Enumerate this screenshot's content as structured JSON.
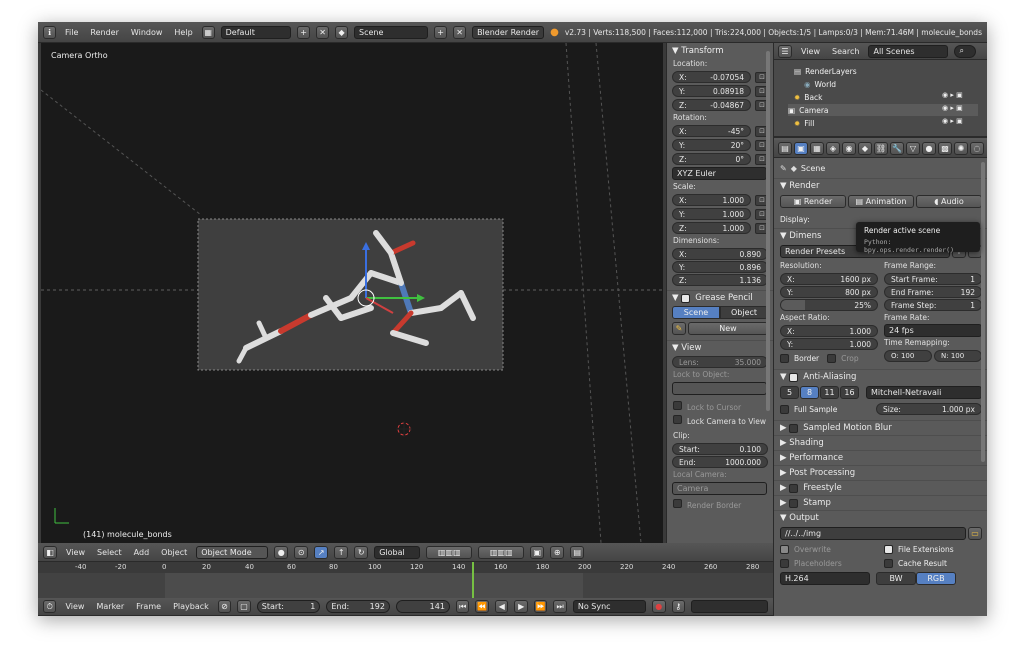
{
  "topbar": {
    "menus": [
      "File",
      "Render",
      "Window",
      "Help"
    ],
    "layout": "Default",
    "scene": "Scene",
    "engine": "Blender Render",
    "stats": "v2.73 | Verts:118,500 | Faces:112,000 | Tris:224,000 | Objects:1/5 | Lamps:0/3 | Mem:71.46M | molecule_bonds"
  },
  "viewport": {
    "view_label": "Camera Ortho",
    "object_label": "(141) molecule_bonds",
    "header": {
      "menus": [
        "View",
        "Select",
        "Add",
        "Object"
      ],
      "mode": "Object Mode",
      "orientation": "Global"
    }
  },
  "npanel": {
    "transform_title": "Transform",
    "location_label": "Location:",
    "location": [
      {
        "axis": "X:",
        "value": "-0.07054"
      },
      {
        "axis": "Y:",
        "value": "0.08918"
      },
      {
        "axis": "Z:",
        "value": "-0.04867"
      }
    ],
    "rotation_label": "Rotation:",
    "rotation": [
      {
        "axis": "X:",
        "value": "-45°"
      },
      {
        "axis": "Y:",
        "value": "20°"
      },
      {
        "axis": "Z:",
        "value": "0°"
      }
    ],
    "rotation_mode": "XYZ Euler",
    "scale_label": "Scale:",
    "scale": [
      {
        "axis": "X:",
        "value": "1.000"
      },
      {
        "axis": "Y:",
        "value": "1.000"
      },
      {
        "axis": "Z:",
        "value": "1.000"
      }
    ],
    "dimensions_label": "Dimensions:",
    "dimensions": [
      {
        "axis": "X:",
        "value": "0.890"
      },
      {
        "axis": "Y:",
        "value": "0.896"
      },
      {
        "axis": "Z:",
        "value": "1.136"
      }
    ],
    "grease_title": "Grease Pencil",
    "grease_tabs": [
      "Scene",
      "Object"
    ],
    "grease_new": "New",
    "view_title": "View",
    "lens_label": "Lens:",
    "lens_value": "35.000",
    "lock_object_label": "Lock to Object:",
    "lock_cursor": "Lock to Cursor",
    "lock_camera": "Lock Camera to View",
    "clip_label": "Clip:",
    "clip_start_label": "Start:",
    "clip_start": "0.100",
    "clip_end_label": "End:",
    "clip_end": "1000.000",
    "local_camera_label": "Local Camera:",
    "local_camera": "Camera",
    "render_border": "Render Border"
  },
  "timeline": {
    "ticks": [
      "-40",
      "-20",
      "0",
      "20",
      "40",
      "60",
      "80",
      "100",
      "120",
      "140",
      "160",
      "180",
      "200",
      "220",
      "240",
      "260",
      "280"
    ],
    "menus": [
      "View",
      "Marker",
      "Frame",
      "Playback"
    ],
    "start_label": "Start:",
    "start": "1",
    "end_label": "End:",
    "end": "192",
    "current": "141",
    "sync": "No Sync"
  },
  "outliner": {
    "menus": [
      "View",
      "Search"
    ],
    "filter": "All Scenes",
    "items": [
      "RenderLayers",
      "World",
      "Back",
      "Camera",
      "Fill"
    ]
  },
  "properties": {
    "scene_label": "Scene",
    "render_title": "Render",
    "render_buttons": [
      "Render",
      "Animation",
      "Audio"
    ],
    "display_label": "Display:",
    "dimensions_title": "Dimens",
    "render_presets": "Render Presets",
    "resolution_label": "Resolution:",
    "res_x_label": "X:",
    "res_x": "1600 px",
    "res_y_label": "Y:",
    "res_y": "800 px",
    "res_pct": "25%",
    "res_pct_fill": 0.25,
    "frame_range_label": "Frame Range:",
    "start_frame_label": "Start Frame:",
    "start_frame": "1",
    "end_frame_label": "End Frame:",
    "end_frame": "192",
    "frame_step_label": "Frame Step:",
    "frame_step": "1",
    "aspect_label": "Aspect Ratio:",
    "aspect_x_label": "X:",
    "aspect_x": "1.000",
    "aspect_y_label": "Y:",
    "aspect_y": "1.000",
    "frame_rate_label": "Frame Rate:",
    "frame_rate": "24 fps",
    "border": "Border",
    "crop": "Crop",
    "time_remap_label": "Time Remapping:",
    "remap_o": "O: 100",
    "remap_n": "N: 100",
    "aa_title": "Anti-Aliasing",
    "aa_samples": [
      "5",
      "8",
      "11",
      "16"
    ],
    "aa_filter": "Mitchell-Netravali",
    "full_sample": "Full Sample",
    "size_label": "Size:",
    "size_value": "1.000 px",
    "collapsed_sections": [
      "Sampled Motion Blur",
      "Shading",
      "Performance",
      "Post Processing",
      "Freestyle",
      "Stamp"
    ],
    "output_title": "Output",
    "output_path": "//../../img",
    "overwrite": "Overwrite",
    "file_extensions": "File Extensions",
    "placeholders": "Placeholders",
    "cache_result": "Cache Result",
    "format": "H.264",
    "color_modes": [
      "BW",
      "RGB"
    ]
  },
  "tooltip": {
    "title": "Render active scene",
    "code": "Python: bpy.ops.render.render()"
  },
  "colors": {
    "accent": "#5680c2",
    "timeline_cursor": "#76c043"
  }
}
